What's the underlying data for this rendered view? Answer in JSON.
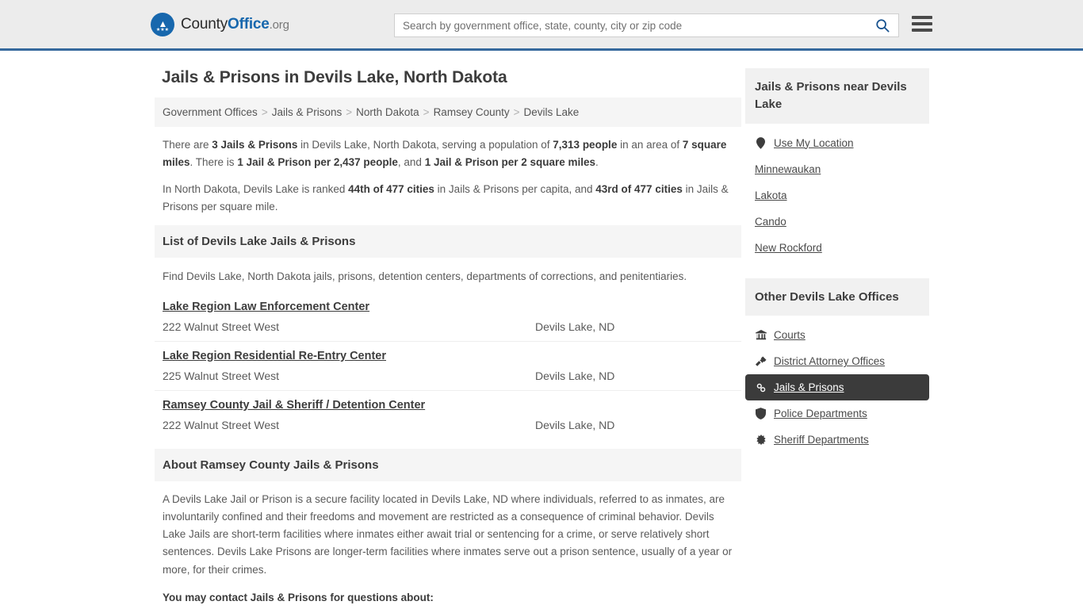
{
  "header": {
    "logo": {
      "part1": "County",
      "part2": "Office",
      "part3": ".org",
      "icon": "eagle-seal-icon"
    },
    "search": {
      "placeholder": "Search by government office, state, county, city or zip code",
      "value": ""
    },
    "search_icon": "search-icon",
    "menu_icon": "hamburger-menu-icon",
    "accent_color": "#36699d",
    "logo_color": "#1767ad"
  },
  "main": {
    "title": "Jails & Prisons in Devils Lake, North Dakota",
    "breadcrumb": [
      "Government Offices",
      "Jails & Prisons",
      "North Dakota",
      "Ramsey County",
      "Devils Lake"
    ],
    "breadcrumb_separator": ">",
    "stats": {
      "line1": [
        {
          "t": "There are ",
          "b": false
        },
        {
          "t": "3 Jails & Prisons",
          "b": true
        },
        {
          "t": " in Devils Lake, North Dakota, serving a population of ",
          "b": false
        },
        {
          "t": "7,313 people",
          "b": true
        },
        {
          "t": " in an area of ",
          "b": false
        },
        {
          "t": "7 square miles",
          "b": true
        },
        {
          "t": ". There is ",
          "b": false
        },
        {
          "t": "1 Jail & Prison per 2,437 people",
          "b": true
        },
        {
          "t": ", and ",
          "b": false
        },
        {
          "t": "1 Jail & Prison per 2 square miles",
          "b": true
        },
        {
          "t": ".",
          "b": false
        }
      ],
      "line2": [
        {
          "t": "In North Dakota, Devils Lake is ranked ",
          "b": false
        },
        {
          "t": "44th of 477 cities",
          "b": true
        },
        {
          "t": " in Jails & Prisons per capita, and ",
          "b": false
        },
        {
          "t": "43rd of 477 cities",
          "b": true
        },
        {
          "t": " in Jails & Prisons per square mile.",
          "b": false
        }
      ]
    },
    "list_section": {
      "heading": "List of Devils Lake Jails & Prisons",
      "note": "Find Devils Lake, North Dakota jails, prisons, detention centers, departments of corrections, and penitentiaries.",
      "items": [
        {
          "name": "Lake Region Law Enforcement Center",
          "address": "222 Walnut Street West",
          "city": "Devils Lake, ND"
        },
        {
          "name": "Lake Region Residential Re-Entry Center",
          "address": "225 Walnut Street West",
          "city": "Devils Lake, ND"
        },
        {
          "name": "Ramsey County Jail & Sheriff / Detention Center",
          "address": "222 Walnut Street West",
          "city": "Devils Lake, ND"
        }
      ]
    },
    "about_section": {
      "heading": "About Ramsey County Jails & Prisons",
      "paragraph": "A Devils Lake Jail or Prison is a secure facility located in Devils Lake, ND where individuals, referred to as inmates, are involuntarily confined and their freedoms and movement are restricted as a consequence of criminal behavior. Devils Lake Jails are short-term facilities where inmates either await trial or sentencing for a crime, or serve relatively short sentences. Devils Lake Prisons are longer-term facilities where inmates serve out a prison sentence, usually of a year or more, for their crimes.",
      "contact_intro": "You may contact Jails & Prisons for questions about:"
    }
  },
  "sidebar": {
    "nearby": {
      "heading": "Jails & Prisons near Devils Lake",
      "use_my_location": {
        "label": "Use My Location",
        "icon": "map-pin-icon"
      },
      "cities": [
        "Minnewaukan",
        "Lakota",
        "Cando",
        "New Rockford"
      ]
    },
    "other_offices": {
      "heading": "Other Devils Lake Offices",
      "items": [
        {
          "label": "Courts",
          "icon": "courthouse-icon",
          "active": false
        },
        {
          "label": "District Attorney Offices",
          "icon": "gavel-icon",
          "active": false
        },
        {
          "label": "Jails & Prisons",
          "icon": "handcuffs-icon",
          "active": true
        },
        {
          "label": "Police Departments",
          "icon": "shield-icon",
          "active": false
        },
        {
          "label": "Sheriff Departments",
          "icon": "star-badge-icon",
          "active": false
        }
      ],
      "active_bg": "#3b3b3b"
    }
  }
}
